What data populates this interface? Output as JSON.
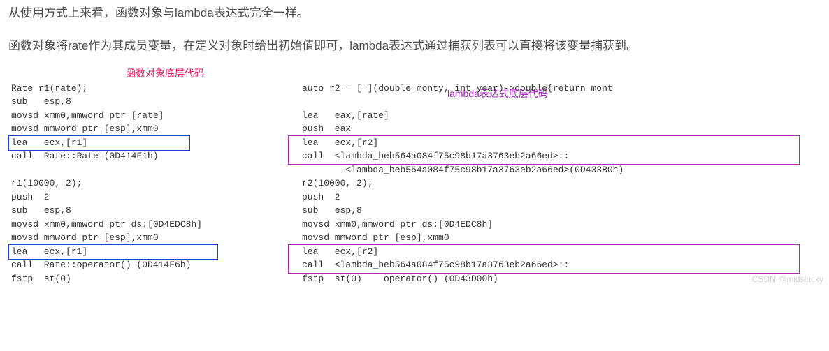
{
  "paragraphs": {
    "p1": "从使用方式上来看，函数对象与lambda表达式完全一样。",
    "p2": "函数对象将rate作为其成员变量，在定义对象时给出初始值即可，lambda表达式通过捕获列表可以直接将该变量捕获到。"
  },
  "annotations": {
    "left_label": "函数对象底层代码",
    "right_label": "lambda表达式底层代码"
  },
  "left_code": {
    "l1": "Rate r1(rate);",
    "l2": "sub   esp,8",
    "l3": "movsd xmm0,mmword ptr [rate]",
    "l4": "movsd mmword ptr [esp],xmm0",
    "l5": "lea   ecx,[r1]",
    "l6": "call  Rate::Rate (0D414F1h)",
    "l7": "r1(10000, 2);",
    "l8": "push  2",
    "l9": "sub   esp,8",
    "l10": "movsd xmm0,mmword ptr ds:[0D4EDC8h]",
    "l11": "movsd mmword ptr [esp],xmm0",
    "l12": "lea   ecx,[r1]",
    "l13": "call  Rate::operator() (0D414F6h)",
    "l14": "fstp  st(0)"
  },
  "right_code": {
    "r1": "auto r2 = [=](double monty, int year)->double{return mont",
    "r2": "lea   eax,[rate]",
    "r3": "push  eax",
    "r4": "lea   ecx,[r2]",
    "r5a": "call  <lambda_beb564a084f75c98b17a3763eb2a66ed>::",
    "r5b": "        <lambda_beb564a084f75c98b17a3763eb2a66ed>(0D433B0h)",
    "r6": "r2(10000, 2);",
    "r7": "push  2",
    "r8": "sub   esp,8",
    "r9": "movsd xmm0,mmword ptr ds:[0D4EDC8h]",
    "r10": "movsd mmword ptr [esp],xmm0",
    "r11": "lea   ecx,[r2]",
    "r12a": "call  <lambda_beb564a084f75c98b17a3763eb2a66ed>::",
    "r12b": "fstp  st(0)    operator() (0D43D00h)"
  },
  "watermark": "CSDN @midslucky"
}
